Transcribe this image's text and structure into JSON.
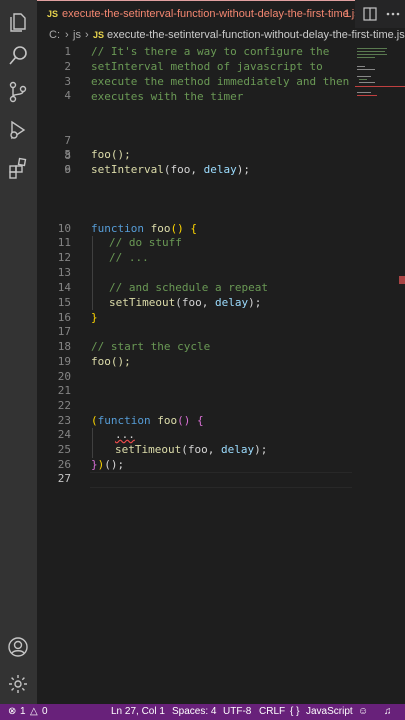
{
  "tab": {
    "file_type": "JS",
    "filename": "execute-the-setinterval-function-without-delay-the-first-time.js",
    "problem_count": "1"
  },
  "breadcrumb": {
    "drive": "C:",
    "folder": "js",
    "file_type": "JS",
    "file": "execute-the-setinterval-function-without-delay-the-first-time.js"
  },
  "editor": {
    "line_numbers": [
      "1",
      "2",
      "3",
      "4",
      "5",
      "6",
      "7",
      "8",
      "9",
      "10",
      "11",
      "12",
      "13",
      "14",
      "15",
      "16",
      "17",
      "18",
      "19",
      "20",
      "21",
      "22",
      "23",
      "24",
      "25",
      "26",
      "27"
    ],
    "current_line": "27",
    "code": {
      "l1a": "// It's there a way to configure the",
      "l1b": "setInterval method of javascript to",
      "l1c": "execute the method immediately and then",
      "l1d": "executes with the timer",
      "l5": "foo();",
      "l6a": "setInterval",
      "l6b": "(",
      "l6c": "foo",
      "l6d": ", ",
      "l6e": "delay",
      "l6f": ");",
      "l10a": "function",
      "l10b": "foo",
      "l10c": "() {",
      "l11": "// do stuff",
      "l12": "// ...",
      "l14": "// and schedule a repeat",
      "l15a": "setTimeout",
      "l15b": "(foo, ",
      "l15c": "delay",
      "l15d": ");",
      "l16": "}",
      "l18": "// start the cycle",
      "l19": "foo();",
      "l23a": "(",
      "l23b": "function",
      "l23c": "foo",
      "l23d": "() {",
      "l24": "...",
      "l25a": "setTimeout",
      "l25b": "(foo, ",
      "l25c": "delay",
      "l25d": ");",
      "l26a": "}",
      "l26b": ")",
      "l26c": "();"
    }
  },
  "status": {
    "errors": "1",
    "warnings": "0",
    "position": "Ln 27, Col 1",
    "spaces": "Spaces: 4",
    "encoding": "UTF-8",
    "eol": "CRLF",
    "language_icon": "{ }",
    "language": "JavaScript"
  },
  "colors": {
    "statusbar": "#68217a",
    "comment": "#6a9955",
    "keyword": "#569cd6",
    "function": "#dcdcaa",
    "error": "#f48771"
  },
  "icons": [
    "explorer-icon",
    "search-icon",
    "source-control-icon",
    "run-debug-icon",
    "extensions-icon",
    "accounts-icon",
    "manage-gear-icon",
    "split-editor-icon",
    "more-actions-icon"
  ]
}
